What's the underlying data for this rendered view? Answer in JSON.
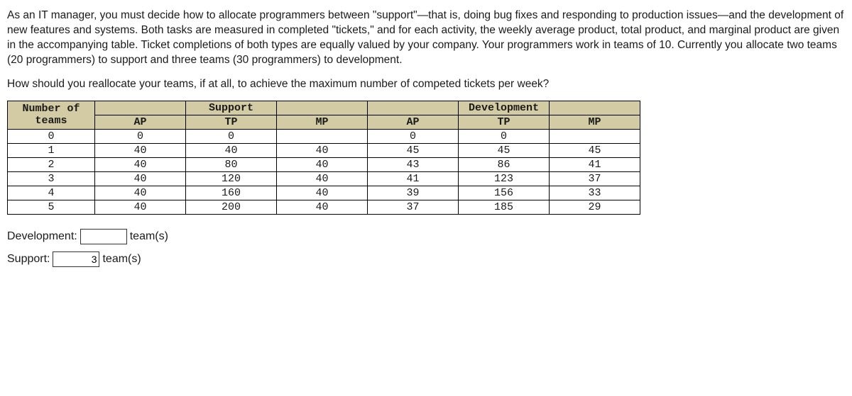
{
  "intro": "As an IT manager, you must decide how to allocate programmers between \"support\"—that is, doing bug fixes and responding to production issues—and the development of new features and systems. Both tasks are measured in completed \"tickets,\" and for each activity, the weekly average product, total product, and marginal product are given in the accompanying table. Ticket completions of both types are equally valued by your company. Your programmers work in teams of 10. Currently you allocate two teams (20 programmers) to support and three teams (30 programmers) to development.",
  "question": "How should you reallocate your teams, if at all, to achieve the maximum number of competed tickets per week?",
  "table": {
    "group_label_teams": "Number of teams",
    "group_label_support": "Support",
    "group_label_development": "Development",
    "col_ap": "AP",
    "col_tp": "TP",
    "col_mp": "MP",
    "rows": [
      {
        "n": "0",
        "s_ap": "0",
        "s_tp": "0",
        "s_mp": "",
        "d_ap": "0",
        "d_tp": "0",
        "d_mp": ""
      },
      {
        "n": "1",
        "s_ap": "40",
        "s_tp": "40",
        "s_mp": "40",
        "d_ap": "45",
        "d_tp": "45",
        "d_mp": "45"
      },
      {
        "n": "2",
        "s_ap": "40",
        "s_tp": "80",
        "s_mp": "40",
        "d_ap": "43",
        "d_tp": "86",
        "d_mp": "41"
      },
      {
        "n": "3",
        "s_ap": "40",
        "s_tp": "120",
        "s_mp": "40",
        "d_ap": "41",
        "d_tp": "123",
        "d_mp": "37"
      },
      {
        "n": "4",
        "s_ap": "40",
        "s_tp": "160",
        "s_mp": "40",
        "d_ap": "39",
        "d_tp": "156",
        "d_mp": "33"
      },
      {
        "n": "5",
        "s_ap": "40",
        "s_tp": "200",
        "s_mp": "40",
        "d_ap": "37",
        "d_tp": "185",
        "d_mp": "29"
      }
    ]
  },
  "answers": {
    "development_label": "Development:",
    "development_value": "",
    "support_label": "Support:",
    "support_value": "3",
    "unit": "team(s)"
  }
}
